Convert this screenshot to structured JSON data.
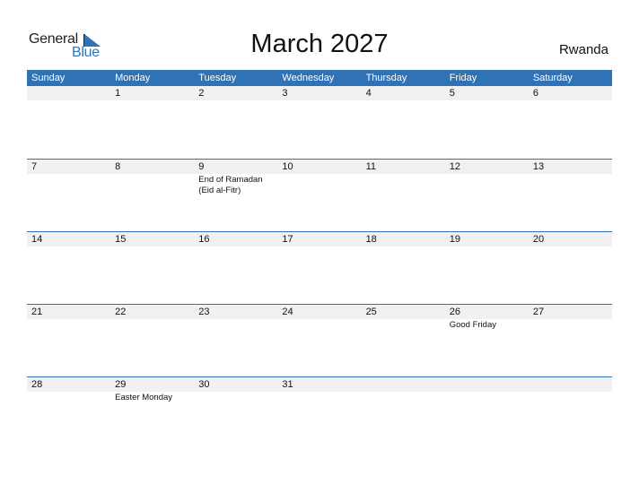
{
  "logo": {
    "general": "General",
    "blue": "Blue"
  },
  "title": "March 2027",
  "country": "Rwanda",
  "colors": {
    "accent": "#2f72b6",
    "date_strip": "#f1f1f1"
  },
  "weekdays": [
    "Sunday",
    "Monday",
    "Tuesday",
    "Wednesday",
    "Thursday",
    "Friday",
    "Saturday"
  ],
  "weeks": [
    {
      "days": [
        "",
        "1",
        "2",
        "3",
        "4",
        "5",
        "6"
      ],
      "events": [
        "",
        "",
        "",
        "",
        "",
        "",
        ""
      ]
    },
    {
      "days": [
        "7",
        "8",
        "9",
        "10",
        "11",
        "12",
        "13"
      ],
      "events": [
        "",
        "",
        "End of Ramadan (Eid al-Fitr)",
        "",
        "",
        "",
        ""
      ]
    },
    {
      "days": [
        "14",
        "15",
        "16",
        "17",
        "18",
        "19",
        "20"
      ],
      "events": [
        "",
        "",
        "",
        "",
        "",
        "",
        ""
      ]
    },
    {
      "days": [
        "21",
        "22",
        "23",
        "24",
        "25",
        "26",
        "27"
      ],
      "events": [
        "",
        "",
        "",
        "",
        "",
        "Good Friday",
        ""
      ]
    },
    {
      "days": [
        "28",
        "29",
        "30",
        "31",
        "",
        "",
        ""
      ],
      "events": [
        "",
        "Easter Monday",
        "",
        "",
        "",
        "",
        ""
      ]
    }
  ]
}
